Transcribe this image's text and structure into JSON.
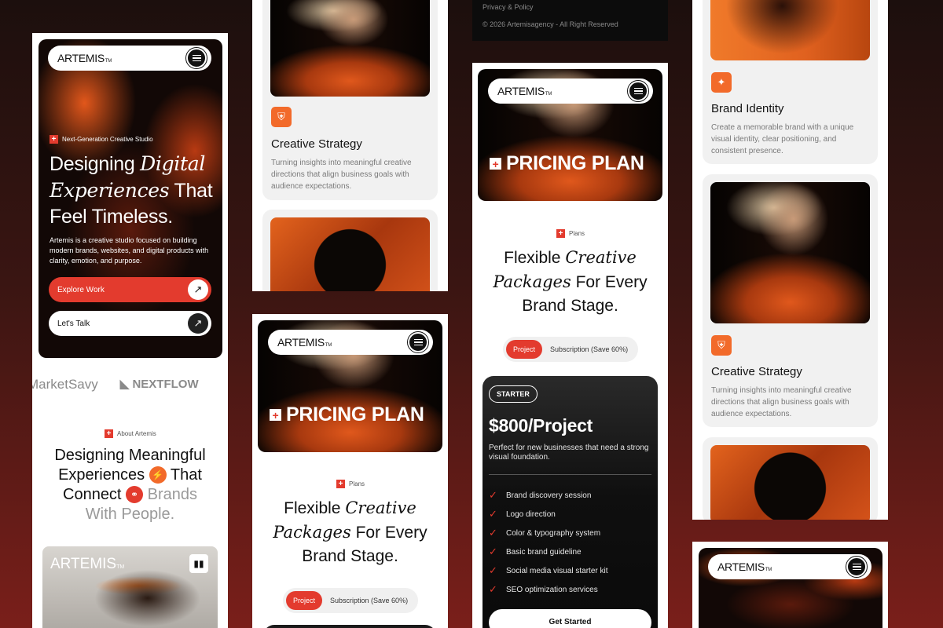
{
  "brand": {
    "name": "ARTEMIS",
    "tm": "TM"
  },
  "screen1": {
    "tag": "Next-Generation Creative Studio",
    "headline_1": "Designing",
    "headline_2_italic": "Digital",
    "headline_3_italic": "Experiences",
    "headline_4": "That",
    "headline_5": "Feel Timeless.",
    "body": "Artemis is a creative studio focused on building modern brands, websites, and digital products with clarity, emotion, and purpose.",
    "cta_primary": "Explore Work",
    "cta_secondary": "Let's Talk",
    "logos": [
      "MarketSavy",
      "NEXTFLOW"
    ],
    "about_tag": "About Artemis",
    "about_line1": "Designing Meaningful",
    "about_line2a": "Experiences",
    "about_line2b": "That",
    "about_line3a": "Connect",
    "about_line3b": "Brands",
    "about_line4": "With People.",
    "card_logo": "ARTEMIS"
  },
  "screen2": {
    "service_title": "Creative Strategy",
    "service_desc": "Turning insights into meaningful creative directions that align business goals with audience expectations."
  },
  "screen3": {
    "pricing_title": "PRICING PLAN",
    "plans_tag": "Plans",
    "head_1": "Flexible",
    "head_2_italic": "Creative",
    "head_3_italic": "Packages",
    "head_4": "For Every",
    "head_5": "Brand Stage.",
    "toggle_on": "Project",
    "toggle_off": "Subscription (Save 60%)"
  },
  "screen4": {
    "footer_link": "Privacy & Policy",
    "copyright": "© 2026 Artemisagency - All Right Reserved",
    "pricing_title": "PRICING PLAN",
    "plans_tag": "Plans",
    "head_1": "Flexible",
    "head_2_italic": "Creative",
    "head_3_italic": "Packages",
    "head_4": "For Every",
    "head_5": "Brand Stage.",
    "toggle_on": "Project",
    "toggle_off": "Subscription (Save 60%)",
    "plan_badge": "STARTER",
    "price": "$800/Project",
    "plan_desc": "Perfect for new businesses that need a strong visual foundation.",
    "features": [
      "Brand discovery session",
      "Logo direction",
      "Color & typography system",
      "Basic brand guideline",
      "Social media visual starter kit",
      "SEO optimization services"
    ],
    "cta": "Get Started"
  },
  "screen5": {
    "service1_title": "Brand Identity",
    "service1_desc": "Create a memorable brand with a unique visual identity, clear positioning, and consistent presence.",
    "service2_title": "Creative Strategy",
    "service2_desc": "Turning insights into meaningful creative directions that align business goals with audience expectations."
  },
  "colors": {
    "accent": "#e33b2e",
    "orange": "#f26a2a",
    "dark": "#111111"
  },
  "icons": [
    "menu-icon",
    "arrow-up-right-icon",
    "plus-square-icon",
    "check-icon",
    "sparkle-icon",
    "bolt-icon",
    "link-icon",
    "chart-icon",
    "shield-icon"
  ]
}
